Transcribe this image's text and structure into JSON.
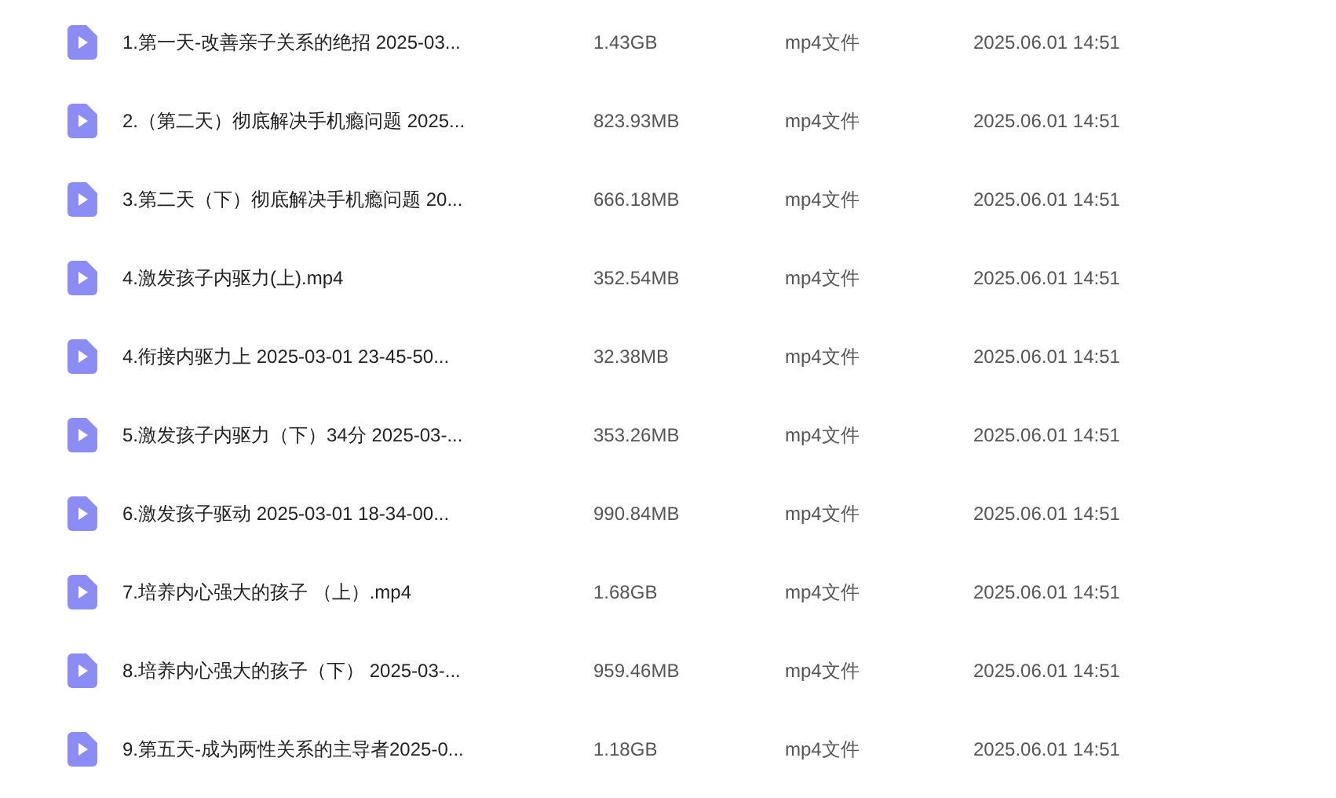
{
  "files": [
    {
      "name": "1.第一天-改善亲子关系的绝招 2025-03...",
      "size": "1.43GB",
      "type": "mp4文件",
      "modified": "2025.06.01 14:51"
    },
    {
      "name": "2.（第二天）彻底解决手机瘾问题 2025...",
      "size": "823.93MB",
      "type": "mp4文件",
      "modified": "2025.06.01 14:51"
    },
    {
      "name": "3.第二天（下）彻底解决手机瘾问题 20...",
      "size": "666.18MB",
      "type": "mp4文件",
      "modified": "2025.06.01 14:51"
    },
    {
      "name": "4.激发孩子内驱力(上).mp4",
      "size": "352.54MB",
      "type": "mp4文件",
      "modified": "2025.06.01 14:51"
    },
    {
      "name": "4.衔接内驱力上 2025-03-01 23-45-50...",
      "size": "32.38MB",
      "type": "mp4文件",
      "modified": "2025.06.01 14:51"
    },
    {
      "name": "5.激发孩子内驱力（下）34分 2025-03-...",
      "size": "353.26MB",
      "type": "mp4文件",
      "modified": "2025.06.01 14:51"
    },
    {
      "name": "6.激发孩子驱动 2025-03-01 18-34-00...",
      "size": "990.84MB",
      "type": "mp4文件",
      "modified": "2025.06.01 14:51"
    },
    {
      "name": "7.培养内心强大的孩子 （上）.mp4",
      "size": "1.68GB",
      "type": "mp4文件",
      "modified": "2025.06.01 14:51"
    },
    {
      "name": "8.培养内心强大的孩子（下） 2025-03-...",
      "size": "959.46MB",
      "type": "mp4文件",
      "modified": "2025.06.01 14:51"
    },
    {
      "name": "9.第五天-成为两性关系的主导者2025-0...",
      "size": "1.18GB",
      "type": "mp4文件",
      "modified": "2025.06.01 14:51"
    }
  ]
}
